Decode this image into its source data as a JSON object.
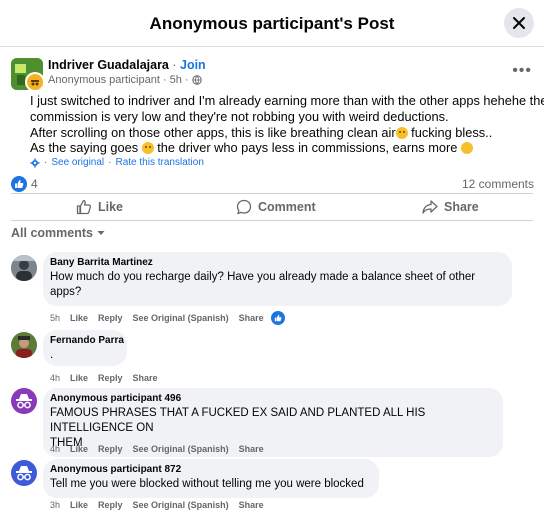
{
  "header": {
    "title": "Anonymous participant's Post"
  },
  "post": {
    "group_name": "Indriver Guadalajara",
    "dot": " · ",
    "join_label": "Join",
    "author": "Anonymous participant",
    "time": "5h",
    "more": "•••",
    "body_lines": [
      "I just switched to indriver and I'm already earning more than with the other apps hehehe the",
      "commission is very low and they're not robbing you with weird deductions.",
      "After scrolling on those other apps, this is like breathing clean air",
      " fucking bless..",
      "As the saying goes ",
      " the driver who pays less in commissions, earns more "
    ],
    "see_original": "See original",
    "translate_sep": "·",
    "rate_translation": "Rate this translation",
    "reaction_count": "4",
    "comments_count": "12 comments"
  },
  "actions": {
    "like": "Like",
    "comment": "Comment",
    "share": "Share"
  },
  "comments_filter": "All comments",
  "comments": [
    {
      "name": "Bany Barrita Martinez",
      "text_lines": [
        "How much do you recharge daily? Have you already made a balance sheet of other",
        "apps?"
      ],
      "time": "5h",
      "like": "Like",
      "reply": "Reply",
      "see_original": "See Original (Spanish)",
      "share": "Share"
    },
    {
      "name": "Fernando Parra",
      "text_lines": [
        "."
      ],
      "time": "4h",
      "like": "Like",
      "reply": "Reply",
      "share": "Share"
    },
    {
      "name": "Anonymous participant 496",
      "text_lines": [
        "FAMOUS PHRASES THAT A FUCKED EX SAID AND PLANTED ALL HIS INTELLIGENCE ON",
        "THEM"
      ],
      "time": "4h",
      "like": "Like",
      "reply": "Reply",
      "see_original": "See Original (Spanish)",
      "share": "Share"
    },
    {
      "name": "Anonymous participant 872",
      "text_lines": [
        "Tell me you were blocked without telling me you were blocked"
      ],
      "time": "3h",
      "like": "Like",
      "reply": "Reply",
      "see_original": "See Original (Spanish)",
      "share": "Share"
    }
  ],
  "colors": {
    "accent": "#1b74e4",
    "muted": "#65676b",
    "bubble": "#f0f2f5"
  }
}
